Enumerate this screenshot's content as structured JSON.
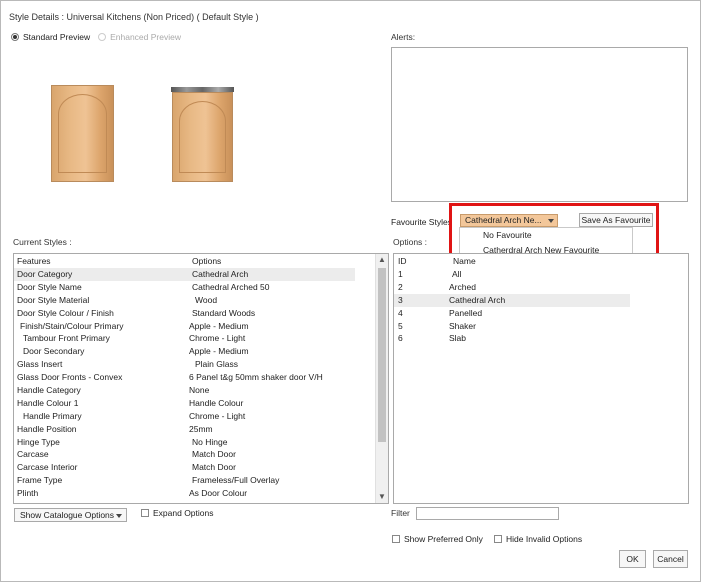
{
  "window": {
    "title": "Style Details : Universal Kitchens (Non Priced) ( Default Style )"
  },
  "preview_mode": {
    "standard_label": "Standard Preview",
    "enhanced_label": "Enhanced Preview",
    "selected": "standard"
  },
  "alerts": {
    "label": "Alerts:"
  },
  "favourite": {
    "label": "Favourite Styles",
    "selected_value": "Cathedral Arch Ne...",
    "save_button": "Save As Favourite",
    "dropdown_options": [
      "No Favourite",
      "Catherdral Arch New Favourite"
    ]
  },
  "current_styles": {
    "label": "Current Styles :",
    "headers": [
      "Features",
      "Options"
    ],
    "selected_index": 0,
    "rows": [
      [
        "Door Category",
        "Cathedral Arch"
      ],
      [
        "Door Style Name",
        "Cathedral Arched 50"
      ],
      [
        "Door Style Material",
        "Wood"
      ],
      [
        "Door Style Colour / Finish",
        "Standard Woods"
      ],
      [
        "Finish/Stain/Colour Primary",
        "Apple - Medium"
      ],
      [
        "Tambour Front Primary",
        "Chrome - Light"
      ],
      [
        "Door Secondary",
        "Apple - Medium"
      ],
      [
        "Glass Insert",
        "Plain Glass"
      ],
      [
        "Glass Door Fronts - Convex",
        "6 Panel t&g 50mm shaker door V/H"
      ],
      [
        "Handle Category",
        "None"
      ],
      [
        "Handle Colour 1",
        "Handle Colour"
      ],
      [
        "Handle Primary",
        "Chrome - Light"
      ],
      [
        "Handle Position",
        "25mm"
      ],
      [
        "Hinge Type",
        "No Hinge"
      ],
      [
        "Carcase",
        "Match Door"
      ],
      [
        "Carcase Interior",
        "Match Door"
      ],
      [
        "Frame Type",
        "Frameless/Full Overlay"
      ],
      [
        "Plinth",
        "As Door Colour"
      ]
    ],
    "feature_indent": [
      0,
      0,
      0,
      0,
      1,
      2,
      2,
      0,
      0,
      0,
      0,
      2,
      0,
      0,
      0,
      0,
      0,
      0
    ],
    "option_indent": [
      1,
      1,
      2,
      1,
      0,
      0,
      0,
      2,
      0,
      0,
      0,
      0,
      0,
      1,
      1,
      1,
      1,
      0
    ],
    "catalogue_dropdown": "Show Catalogue Options",
    "expand_label": "Expand Options"
  },
  "options_panel": {
    "label": "Options :",
    "headers": [
      "ID",
      "Name"
    ],
    "selected_index": 3,
    "rows": [
      [
        "1",
        "All"
      ],
      [
        "2",
        "Arched"
      ],
      [
        "3",
        "Cathedral Arch"
      ],
      [
        "4",
        "Panelled"
      ],
      [
        "5",
        "Shaker"
      ],
      [
        "6",
        "Slab"
      ]
    ],
    "filter_label": "Filter",
    "show_preferred_label": "Show Preferred Only",
    "hide_invalid_label": "Hide Invalid Options"
  },
  "buttons": {
    "ok": "OK",
    "cancel": "Cancel"
  }
}
